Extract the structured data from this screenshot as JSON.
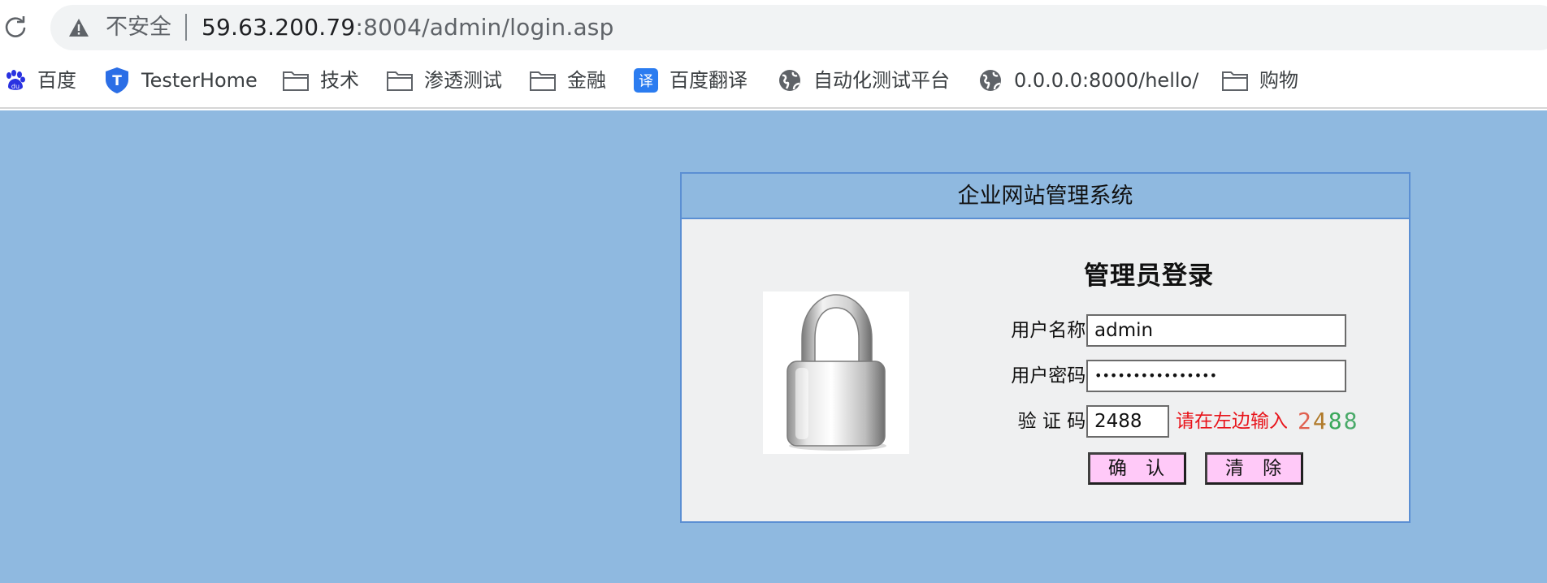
{
  "browser": {
    "security_label": "不安全",
    "url_host": "59.63.200.79",
    "url_rest": ":8004/admin/login.asp",
    "reload_icon": "reload-icon",
    "warning_icon": "warning-triangle-icon"
  },
  "bookmarks": [
    {
      "label": "百度",
      "icon": "baidu-icon"
    },
    {
      "label": "TesterHome",
      "icon": "testerhome-shield-icon"
    },
    {
      "label": "技术",
      "icon": "folder-icon"
    },
    {
      "label": "渗透测试",
      "icon": "folder-icon"
    },
    {
      "label": "金融",
      "icon": "folder-icon"
    },
    {
      "label": "百度翻译",
      "icon": "baidu-translate-icon"
    },
    {
      "label": "自动化测试平台",
      "icon": "globe-icon"
    },
    {
      "label": "0.0.0.0:8000/hello/",
      "icon": "globe-icon"
    },
    {
      "label": "购物",
      "icon": "folder-icon"
    }
  ],
  "translate_glyph": "译",
  "testerhome_glyph": "T",
  "panel": {
    "title": "企业网站管理系统",
    "login_title": "管理员登录",
    "lock_image": "padlock-icon"
  },
  "form": {
    "username_label": "用户名称:",
    "username_value": "admin",
    "password_label": "用户密码:",
    "password_value": "••••••••••••••••",
    "code_label": "验 证 码:",
    "code_value": "2488",
    "code_hint": "请在左边输入",
    "captcha_digits": [
      "2",
      "4",
      "8",
      "8"
    ],
    "captcha_colors": [
      "#e0604f",
      "#b07a2a",
      "#3aa85a",
      "#4aaa6a"
    ],
    "confirm_label": "确 认",
    "clear_label": "清 除"
  },
  "colors": {
    "page_bg": "#8fb9e0",
    "panel_border": "#5b8fd3",
    "button_bg": "#ffc9f8",
    "hint": "#e8141b"
  }
}
